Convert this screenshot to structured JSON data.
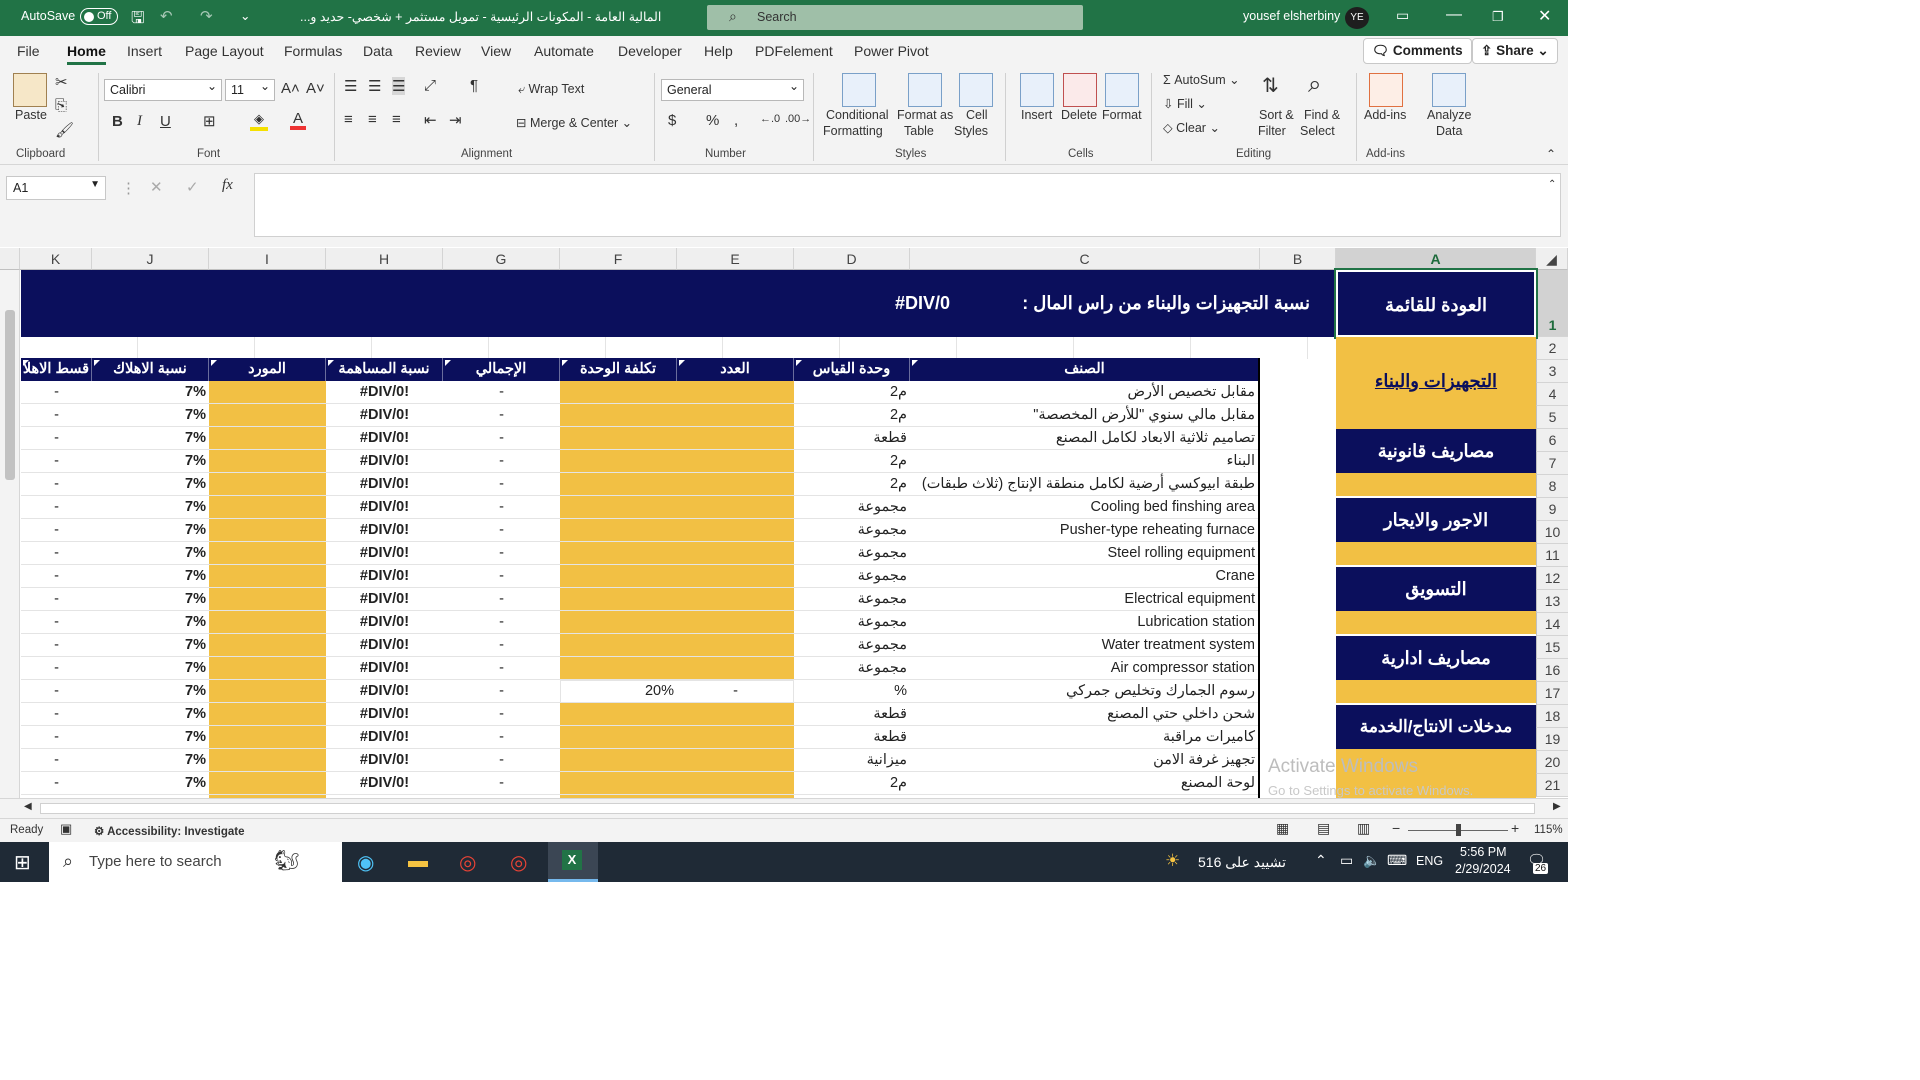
{
  "titlebar": {
    "autosave_label": "AutoSave",
    "autosave_state": "Off",
    "filename": "المالية العامة - المكونات الرئيسية - تمويل مستثمر + شخصي- حديد و...",
    "search_placeholder": "Search",
    "user_name": "yousef elsherbiny",
    "user_initials": "YE"
  },
  "menu_tabs": [
    "File",
    "Home",
    "Insert",
    "Page Layout",
    "Formulas",
    "Data",
    "Review",
    "View",
    "Automate",
    "Developer",
    "Help",
    "PDFelement",
    "Power Pivot"
  ],
  "active_tab": "Home",
  "header_buttons": {
    "comments": "Comments",
    "share": "Share"
  },
  "ribbon": {
    "clipboard": {
      "group": "Clipboard",
      "paste": "Paste"
    },
    "font": {
      "group": "Font",
      "font_name": "Calibri",
      "font_size": "11"
    },
    "alignment": {
      "group": "Alignment",
      "wrap_text": "Wrap Text",
      "merge_center": "Merge & Center"
    },
    "number": {
      "group": "Number",
      "format": "General"
    },
    "styles": {
      "group": "Styles",
      "conditional": "Conditional",
      "formatting": "Formatting",
      "format_as": "Format as",
      "table": "Table",
      "cell": "Cell",
      "styles": "Styles"
    },
    "cells": {
      "group": "Cells",
      "insert": "Insert",
      "delete": "Delete",
      "format": "Format"
    },
    "editing": {
      "group": "Editing",
      "autosum": "AutoSum",
      "fill": "Fill",
      "clear": "Clear",
      "sort1": "Sort &",
      "sort2": "Filter",
      "find1": "Find &",
      "find2": "Select"
    },
    "addins": {
      "group": "Add-ins",
      "addins": "Add-ins",
      "analyze1": "Analyze",
      "analyze2": "Data"
    }
  },
  "formula_bar": {
    "name_box": "A1",
    "fx": "fx",
    "formula": ""
  },
  "columns": [
    "K",
    "J",
    "I",
    "H",
    "G",
    "F",
    "E",
    "D",
    "C",
    "B",
    "A"
  ],
  "rows": [
    "1",
    "2",
    "3",
    "4",
    "5",
    "6",
    "7",
    "8",
    "9",
    "10",
    "11",
    "12",
    "13",
    "14",
    "15",
    "16",
    "17",
    "18",
    "19",
    "20",
    "21"
  ],
  "sheet": {
    "title": "نسبة التجهيزات والبناء من راس المال :",
    "title_value": "#DIV/0",
    "headers": {
      "item": "الصنف",
      "unit": "وحدة القياس",
      "count": "العدد",
      "unit_cost": "تكلفة الوحدة",
      "total": "الإجمالي",
      "contrib": "نسبة المساهمة",
      "supplier": "المورد",
      "depr": "نسبة الاهلاك",
      "install": "قسط الاهلا"
    },
    "rows": [
      {
        "item": "مقابل تخصيص الأرض",
        "unit": "م2",
        "count": "",
        "cost": "",
        "total": "-",
        "contrib": "#DIV/0!",
        "depr": "7%",
        "inst": "-"
      },
      {
        "item": "مقابل مالي سنوي \"للأرض المخصصة\"",
        "unit": "م2",
        "count": "",
        "cost": "",
        "total": "-",
        "contrib": "#DIV/0!",
        "depr": "7%",
        "inst": "-"
      },
      {
        "item": "تصاميم ثلاثية الابعاد لكامل المصنع",
        "unit": "قطعة",
        "count": "",
        "cost": "",
        "total": "-",
        "contrib": "#DIV/0!",
        "depr": "7%",
        "inst": "-"
      },
      {
        "item": "البناء",
        "unit": "م2",
        "count": "",
        "cost": "",
        "total": "-",
        "contrib": "#DIV/0!",
        "depr": "7%",
        "inst": "-"
      },
      {
        "item": "طبقة ابيوكسي أرضية لكامل منطقة الإنتاج (ثلاث طبقات)",
        "unit": "م2",
        "count": "",
        "cost": "",
        "total": "-",
        "contrib": "#DIV/0!",
        "depr": "7%",
        "inst": "-"
      },
      {
        "item": "Cooling bed finshing area",
        "unit": "مجموعة",
        "count": "",
        "cost": "",
        "total": "-",
        "contrib": "#DIV/0!",
        "depr": "7%",
        "inst": "-"
      },
      {
        "item": "Pusher-type reheating furnace",
        "unit": "مجموعة",
        "count": "",
        "cost": "",
        "total": "-",
        "contrib": "#DIV/0!",
        "depr": "7%",
        "inst": "-"
      },
      {
        "item": "Steel rolling equipment",
        "unit": "مجموعة",
        "count": "",
        "cost": "",
        "total": "-",
        "contrib": "#DIV/0!",
        "depr": "7%",
        "inst": "-"
      },
      {
        "item": "Crane",
        "unit": "مجموعة",
        "count": "",
        "cost": "",
        "total": "-",
        "contrib": "#DIV/0!",
        "depr": "7%",
        "inst": "-"
      },
      {
        "item": "Electrical equipment",
        "unit": "مجموعة",
        "count": "",
        "cost": "",
        "total": "-",
        "contrib": "#DIV/0!",
        "depr": "7%",
        "inst": "-"
      },
      {
        "item": "Lubrication station",
        "unit": "مجموعة",
        "count": "",
        "cost": "",
        "total": "-",
        "contrib": "#DIV/0!",
        "depr": "7%",
        "inst": "-"
      },
      {
        "item": "Water treatment system",
        "unit": "مجموعة",
        "count": "",
        "cost": "",
        "total": "-",
        "contrib": "#DIV/0!",
        "depr": "7%",
        "inst": "-"
      },
      {
        "item": "Air compressor station",
        "unit": "مجموعة",
        "count": "",
        "cost": "",
        "total": "-",
        "contrib": "#DIV/0!",
        "depr": "7%",
        "inst": "-"
      },
      {
        "item": "رسوم الجمارك وتخليص جمركي",
        "unit": "%",
        "count": "-",
        "cost": "20%",
        "total": "-",
        "contrib": "#DIV/0!",
        "depr": "7%",
        "inst": "-"
      },
      {
        "item": "شحن داخلي حتي المصنع",
        "unit": "قطعة",
        "count": "",
        "cost": "",
        "total": "-",
        "contrib": "#DIV/0!",
        "depr": "7%",
        "inst": "-"
      },
      {
        "item": "كاميرات مراقبة",
        "unit": "قطعة",
        "count": "",
        "cost": "",
        "total": "-",
        "contrib": "#DIV/0!",
        "depr": "7%",
        "inst": "-"
      },
      {
        "item": "تجهيز غرفة الامن",
        "unit": "ميزانية",
        "count": "",
        "cost": "",
        "total": "-",
        "contrib": "#DIV/0!",
        "depr": "7%",
        "inst": "-"
      },
      {
        "item": "لوحة المصنع",
        "unit": "م2",
        "count": "",
        "cost": "",
        "total": "-",
        "contrib": "#DIV/0!",
        "depr": "7%",
        "inst": "-"
      }
    ],
    "nav": {
      "back": "العودة للقائمة",
      "equipment": "التجهيزات والبناء",
      "legal": "مصاريف قانونية",
      "wages": "الاجور والايجار",
      "marketing": "التسويق",
      "admin": "مصاريف ادارية",
      "inputs": "مدخلات الانتاج/الخدمة"
    },
    "watermark1": "Activate Windows",
    "watermark2": "Go to Settings to activate Windows."
  },
  "statusbar": {
    "ready": "Ready",
    "accessibility": "Accessibility: Investigate",
    "zoom": "115%"
  },
  "taskbar": {
    "search": "Type here to search",
    "weather": "تشييد على 516",
    "lang": "ENG",
    "time": "5:56 PM",
    "date": "2/29/2024",
    "notif": "26"
  },
  "colors": {
    "excel_green": "#217346",
    "navy": "#0b0f5c",
    "gold": "#f2c044"
  }
}
